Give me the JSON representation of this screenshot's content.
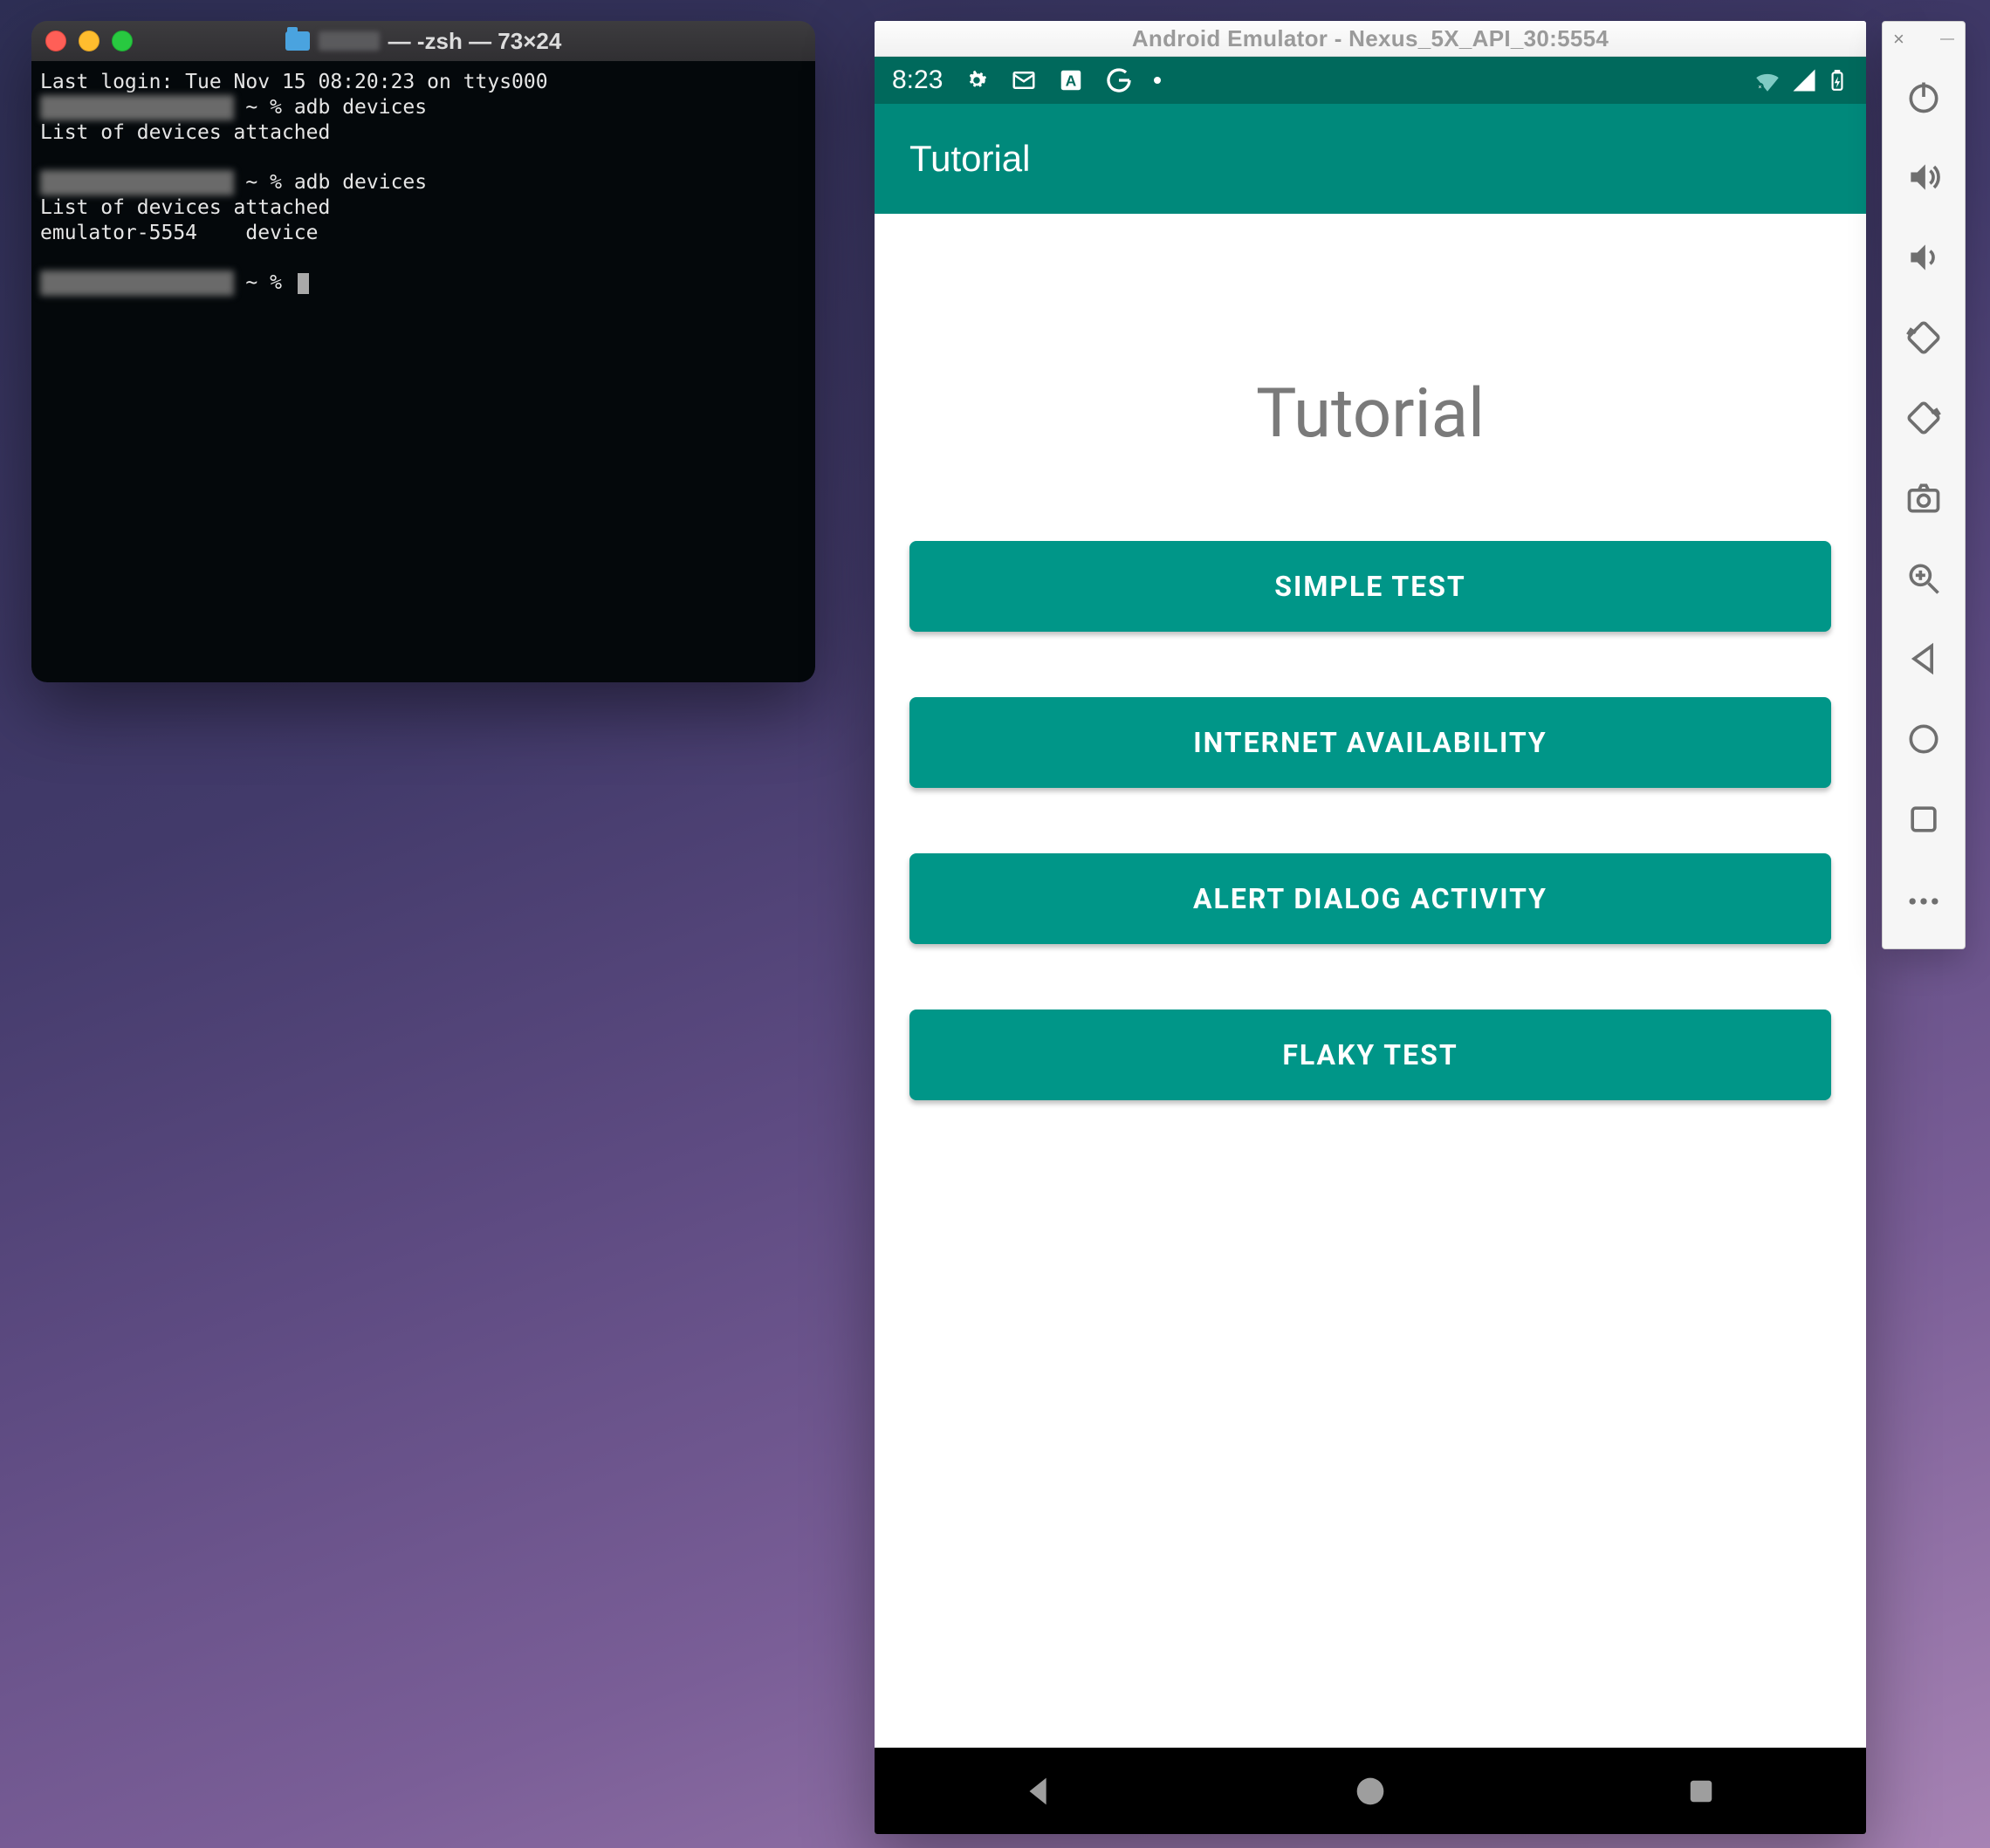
{
  "terminal": {
    "title_suffix": " — -zsh — 73×24",
    "lines": {
      "last_login": "Last login: Tue Nov 15 08:20:23 on ttys000",
      "prompt_suffix": " ~ % ",
      "cmd_adb": "adb devices",
      "list_header": "List of devices attached",
      "device_line": "emulator-5554    device"
    }
  },
  "emulator": {
    "window_title": "Android Emulator - Nexus_5X_API_30:5554",
    "status_time": "8:23",
    "app_bar_title": "Tutorial",
    "screen_title": "Tutorial",
    "buttons": {
      "b1": "SIMPLE TEST",
      "b2": "INTERNET AVAILABILITY",
      "b3": "ALERT DIALOG ACTIVITY",
      "b4": "FLAKY TEST"
    }
  },
  "toolbar": {
    "close": "×",
    "minimize": "—"
  }
}
